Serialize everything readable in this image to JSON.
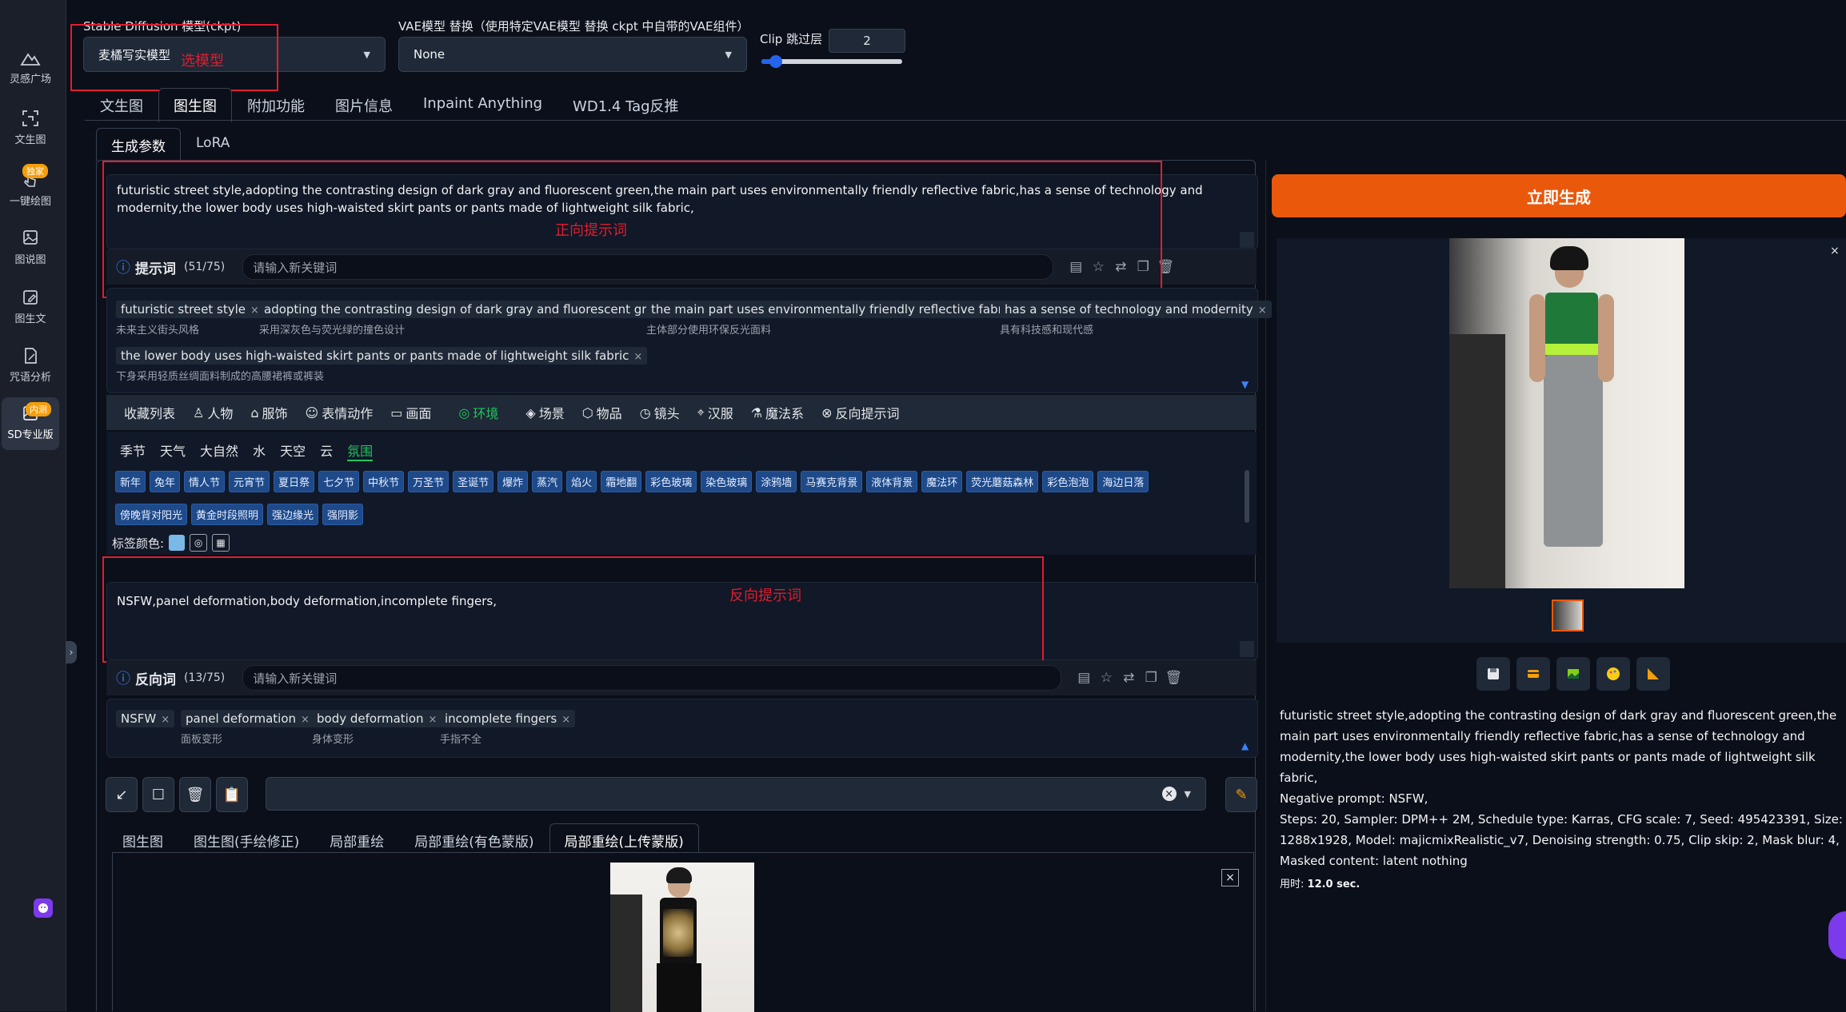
{
  "sidebar": {
    "items": [
      {
        "label": "灵感广场",
        "icon": "mountain-icon"
      },
      {
        "label": "文生图",
        "icon": "scan-icon"
      },
      {
        "label": "一键绘图",
        "icon": "pointer-icon",
        "badge": "独家"
      },
      {
        "label": "图说图",
        "icon": "image-icon"
      },
      {
        "label": "图生文",
        "icon": "edit-image-icon"
      },
      {
        "label": "咒语分析",
        "icon": "analysis-icon"
      },
      {
        "label": "SD专业版",
        "icon": "image-pro-icon",
        "badge": "内测"
      }
    ],
    "collapse_glyph": "›"
  },
  "top": {
    "model_label": "Stable Diffusion 模型(ckpt)",
    "model_value": "麦橘写实模型",
    "model_note": "选模型",
    "vae_label": "VAE模型 替换（使用特定VAE模型 替换 ckpt 中自带的VAE组件）",
    "vae_value": "None",
    "clip_label": "Clip 跳过层",
    "clip_value": "2",
    "clip_fraction": 0.1
  },
  "main_tabs": [
    "文生图",
    "图生图",
    "附加功能",
    "图片信息",
    "Inpaint Anything",
    "WD1.4 Tag反推"
  ],
  "sub_tabs": [
    "生成参数",
    "LoRA"
  ],
  "positive": {
    "text": "futuristic street style,adopting the contrasting design of dark gray and fluorescent green,the main part uses environmentally friendly reflective fabric,has a sense of technology and modernity,the lower body uses high-waisted skirt pants or pants made of lightweight silk fabric,",
    "note": "正向提示词",
    "label": "提示词",
    "count": "(51/75)",
    "placeholder": "请输入新关键词",
    "tags": [
      {
        "en": "futuristic street style",
        "zh": "未来主义街头风格"
      },
      {
        "en": "adopting the contrasting design of dark gray and fluorescent green",
        "zh": "采用深灰色与荧光绿的撞色设计"
      },
      {
        "en": "the main part uses environmentally friendly reflective fabric",
        "zh": "主体部分使用环保反光面料"
      },
      {
        "en": "has a sense of technology and modernity",
        "zh": "具有科技感和现代感"
      },
      {
        "en": "the lower body uses high-waisted skirt pants or pants made of lightweight silk fabric",
        "zh": "下身采用轻质丝绸面料制成的高腰裙裤或裤装"
      }
    ]
  },
  "categories": [
    "收藏列表",
    "人物",
    "服饰",
    "表情动作",
    "画面",
    "环境",
    "场景",
    "物品",
    "镜头",
    "汉服",
    "魔法系",
    "反向提示词"
  ],
  "subcategories": [
    "季节",
    "天气",
    "大自然",
    "水",
    "天空",
    "云",
    "氛围"
  ],
  "chips": [
    "新年",
    "兔年",
    "情人节",
    "元宵节",
    "夏日祭",
    "七夕节",
    "中秋节",
    "万圣节",
    "圣诞节",
    "爆炸",
    "蒸汽",
    "焰火",
    "霜地翻",
    "彩色玻璃",
    "染色玻璃",
    "涂鸦墙",
    "马赛克背景",
    "液体背景",
    "魔法环",
    "荧光蘑菇森林",
    "彩色泡泡",
    "海边日落",
    "傍晚背对阳光",
    "黄金时段照明",
    "强边缘光",
    "强阴影"
  ],
  "tag_color_label": "标签颜色:",
  "negative": {
    "text": "NSFW,panel deformation,body deformation,incomplete fingers,",
    "note": "反向提示词",
    "label": "反向词",
    "count": "(13/75)",
    "placeholder": "请输入新关键词",
    "tags": [
      {
        "en": "NSFW",
        "zh": ""
      },
      {
        "en": "panel deformation",
        "zh": "面板变形"
      },
      {
        "en": "body deformation",
        "zh": "身体变形"
      },
      {
        "en": "incomplete fingers",
        "zh": "手指不全"
      }
    ]
  },
  "style_select_clear": "×",
  "img2img_tabs": [
    "图生图",
    "图生图(手绘修正)",
    "局部重绘",
    "局部重绘(有色蒙版)",
    "局部重绘(上传蒙版)"
  ],
  "generate_label": "立即生成",
  "result": {
    "info_line1": "futuristic street style,adopting the contrasting design of dark gray and fluorescent green,the main part uses environmentally friendly reflective fabric,has a sense of technology and modernity,the lower body uses high-waisted skirt pants or pants made of lightweight silk fabric,",
    "info_negative": "Negative prompt: NSFW,",
    "info_params": "Steps: 20, Sampler: DPM++ 2M, Schedule type: Karras, CFG scale: 7, Seed: 495423391, Size: 1288x1928, Model: majicmixRealistic_v7, Denoising strength: 0.75, Clip skip: 2, Mask blur: 4, Masked content: latent nothing",
    "time_label": "用时:",
    "time_value": "12.0 sec."
  },
  "colors": {
    "accent": "#ea580c",
    "annotation": "#e11d2f",
    "chip": "#1e4a8a",
    "active_green": "#22c55e"
  }
}
